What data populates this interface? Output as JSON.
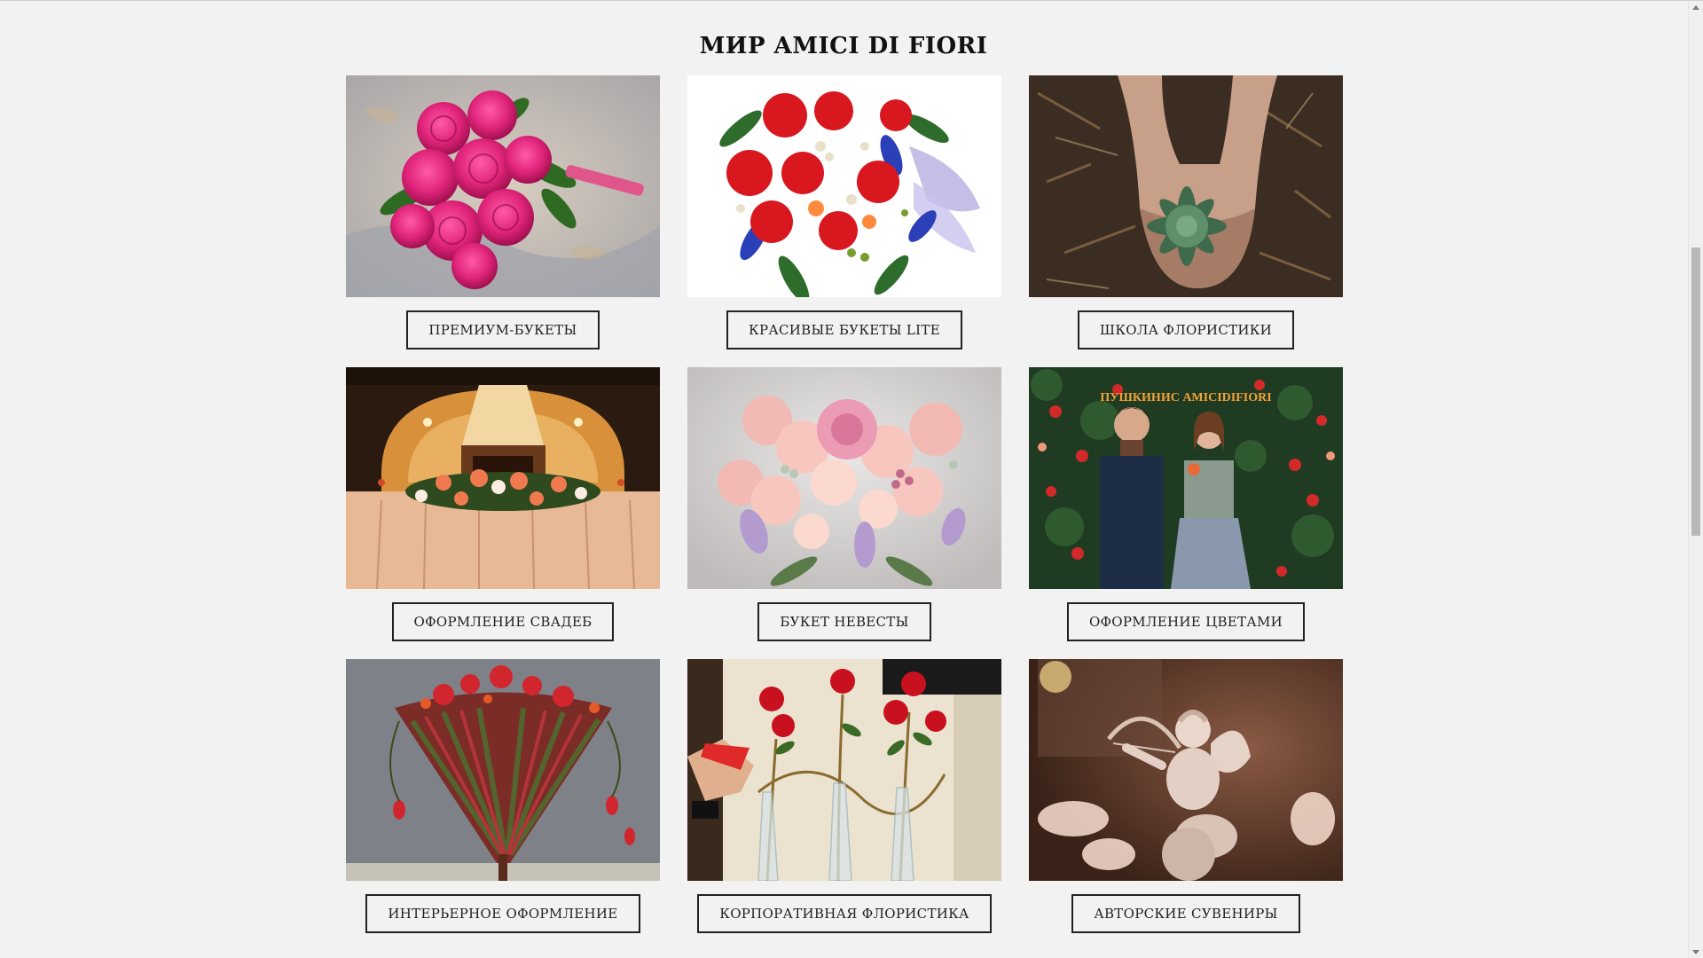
{
  "section": {
    "title": "МИР AMICI DI FIORI"
  },
  "cards": [
    {
      "label": "ПРЕМИУМ-БУКЕТЫ",
      "image": "pink-peony-bouquet"
    },
    {
      "label": "КРАСИВЫЕ БУКЕТЫ LITE",
      "image": "red-ranunculus-bouquet"
    },
    {
      "label": "ШКОЛА ФЛОРИСТИКИ",
      "image": "succulent-in-hands"
    },
    {
      "label": "ОФОРМЛЕНИЕ СВАДЕБ",
      "image": "wedding-banquet-table"
    },
    {
      "label": "БУКЕТ НЕВЕСТЫ",
      "image": "pastel-bridal-bouquet"
    },
    {
      "label": "ОФОРМЛЕНИЕ ЦВЕТАМИ",
      "image": "couple-at-rose-wall"
    },
    {
      "label": "ИНТЕРЬЕРНОЕ ОФОРМЛЕНИЕ",
      "image": "leaf-cone-arrangement"
    },
    {
      "label": "КОРПОРАТИВНАЯ ФЛОРИСТИКА",
      "image": "roses-in-vases"
    },
    {
      "label": "АВТОРСКИЕ СУВЕНИРЫ",
      "image": "cupid-figurine"
    }
  ],
  "rose_wall_sign": "ПУШКИНИС AMICIDIFIORI",
  "colors": {
    "page_bg": "#f2f2f2",
    "text": "#111111",
    "button_border": "#222222"
  }
}
